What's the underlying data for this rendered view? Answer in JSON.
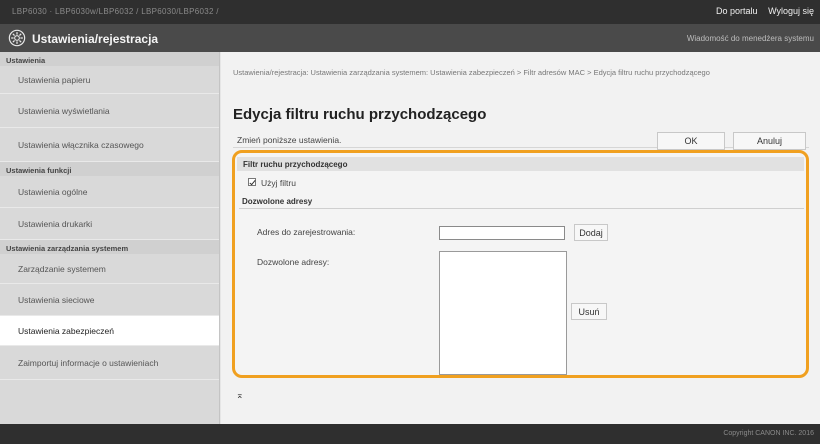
{
  "topbar": {
    "path": "LBP6030 · LBP6030w/LBP6032 / LBP6030/LBP6032 /",
    "portal_link": "Do portalu",
    "logout_link": "Wyloguj się"
  },
  "titlebar": {
    "title": "Ustawienia/rejestracja",
    "admin_message": "Wiadomość do menedżera systemu",
    "icon": "gear-icon"
  },
  "sidebar": {
    "sections": [
      {
        "title": "Ustawienia",
        "items": [
          {
            "label": "Ustawienia papieru"
          },
          {
            "label": "Ustawienia wyświetlania"
          },
          {
            "label": "Ustawienia włącznika czasowego"
          }
        ]
      },
      {
        "title": "Ustawienia funkcji",
        "items": [
          {
            "label": "Ustawienia ogólne"
          },
          {
            "label": "Ustawienia drukarki"
          }
        ]
      },
      {
        "title": "Ustawienia zarządzania systemem",
        "items": [
          {
            "label": "Zarządzanie systemem"
          },
          {
            "label": "Ustawienia sieciowe"
          },
          {
            "label": "Ustawienia zabezpieczeń",
            "active": true
          },
          {
            "label": "Zaimportuj informacje o ustawieniach"
          }
        ]
      }
    ]
  },
  "main": {
    "breadcrumb": "Ustawienia/rejestracja: Ustawienia zarządzania systemem: Ustawienia zabezpieczeń > Filtr adresów MAC > Edycja filtru ruchu przychodzącego",
    "title": "Edycja filtru ruchu przychodzącego",
    "hint": "Zmień poniższe ustawienia.",
    "ok_label": "OK",
    "cancel_label": "Anuluj",
    "group_title": "Filtr ruchu przychodzącego",
    "use_filter_label": "Użyj filtru",
    "use_filter_checked": true,
    "allowed_title": "Dozwolone adresy",
    "register_label": "Adres do zarejestrowania:",
    "register_value": "",
    "add_label": "Dodaj",
    "allowed_list_label": "Dozwolone adresy:",
    "allowed_list": [],
    "delete_label": "Usuń",
    "back_to_top": "⌅",
    "accent_color": "#f0a020"
  },
  "footer": {
    "copyright": "Copyright CANON INC. 2016"
  }
}
